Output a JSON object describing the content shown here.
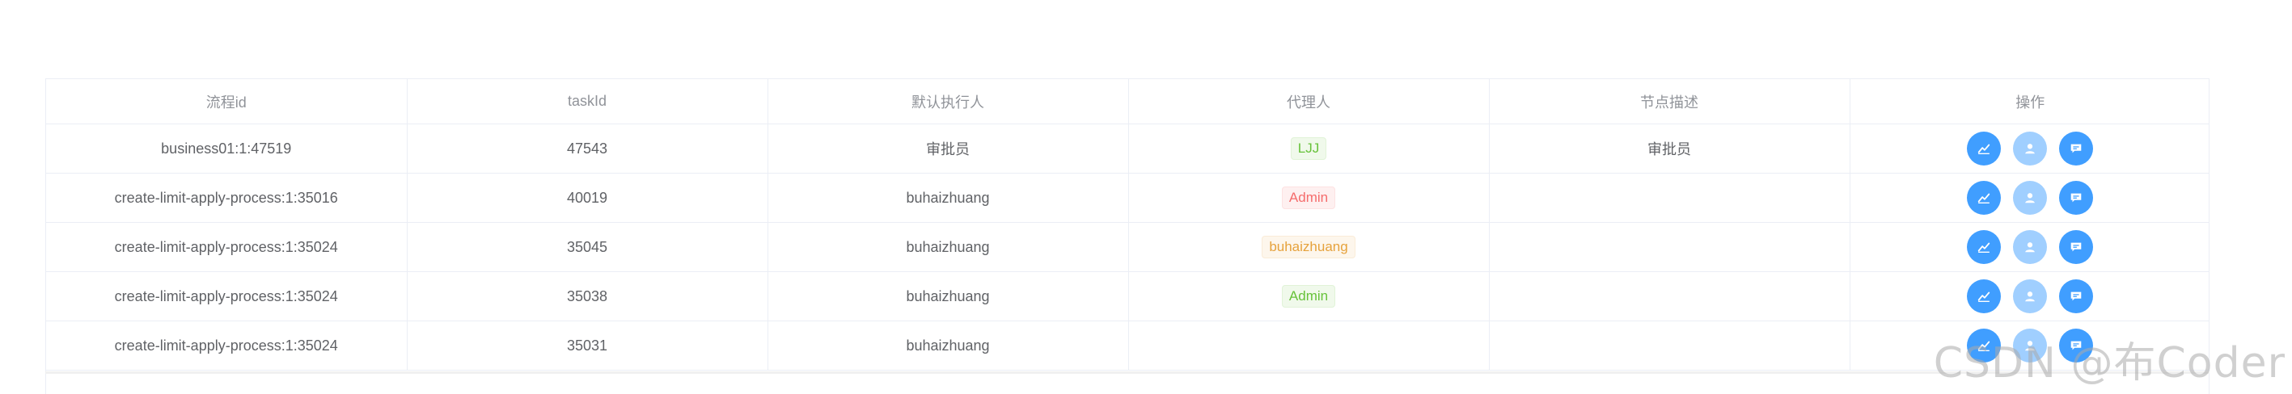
{
  "table": {
    "headers": [
      "流程id",
      "taskId",
      "默认执行人",
      "代理人",
      "节点描述",
      "操作"
    ],
    "rows": [
      {
        "process_id": "business01:1:47519",
        "task_id": "47543",
        "assignee": "审批员",
        "agent": "LJJ",
        "agent_type": "success",
        "description": "审批员"
      },
      {
        "process_id": "create-limit-apply-process:1:35016",
        "task_id": "40019",
        "assignee": "buhaizhuang",
        "agent": "Admin",
        "agent_type": "danger",
        "description": ""
      },
      {
        "process_id": "create-limit-apply-process:1:35024",
        "task_id": "35045",
        "assignee": "buhaizhuang",
        "agent": "buhaizhuang",
        "agent_type": "warning",
        "description": ""
      },
      {
        "process_id": "create-limit-apply-process:1:35024",
        "task_id": "35038",
        "assignee": "buhaizhuang",
        "agent": "Admin",
        "agent_type": "success",
        "description": ""
      },
      {
        "process_id": "create-limit-apply-process:1:35024",
        "task_id": "35031",
        "assignee": "buhaizhuang",
        "agent": "",
        "agent_type": "",
        "description": ""
      }
    ],
    "operations": [
      {
        "name": "approve-icon",
        "disabled": false
      },
      {
        "name": "user-icon",
        "disabled": true
      },
      {
        "name": "comment-icon",
        "disabled": false
      }
    ]
  },
  "colors": {
    "primary": "#409eff",
    "primary_disabled": "#a0cfff",
    "border": "#ebeef5",
    "header_text": "#909399",
    "body_text": "#606266"
  },
  "watermark": "CSDN @布Coder"
}
